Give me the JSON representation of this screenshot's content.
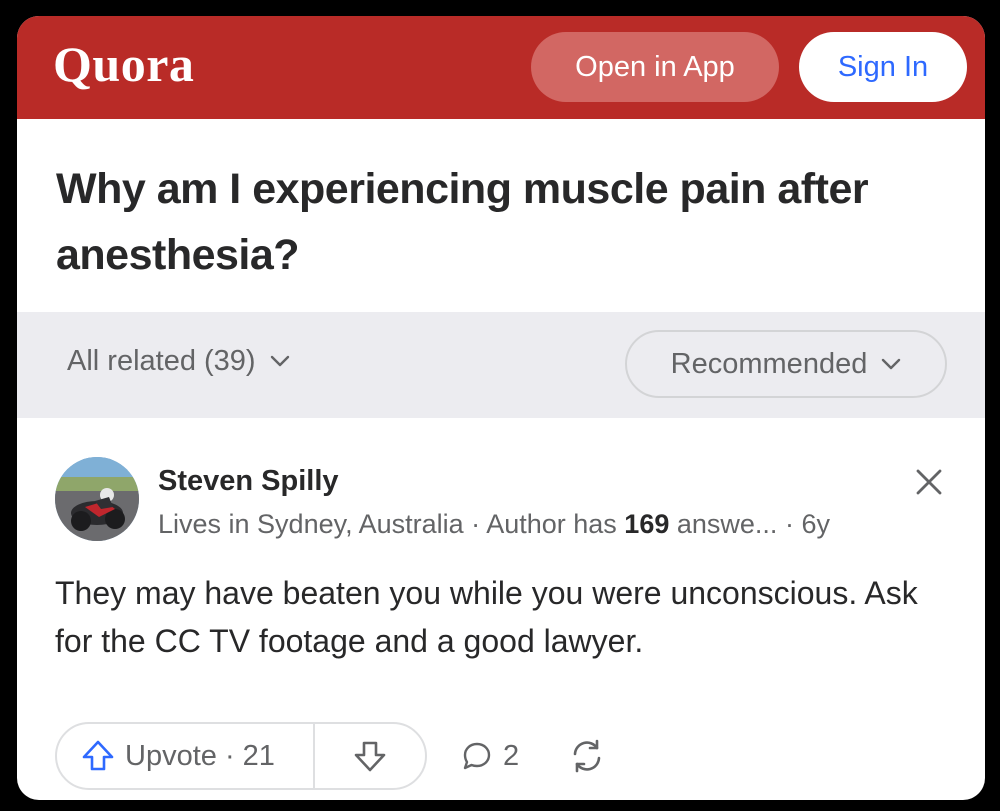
{
  "header": {
    "logo": "Quora",
    "open_in_app_label": "Open in App",
    "sign_in_label": "Sign In",
    "brand_color": "#b92b27"
  },
  "question": {
    "title": "Why am I experiencing muscle pain after anesthesia?"
  },
  "filters": {
    "all_related_label": "All related (39)",
    "sort_label": "Recommended",
    "icons": [
      "chevron-down-icon",
      "chevron-down-icon"
    ]
  },
  "answer": {
    "author_name": "Steven Spilly",
    "author_location": "Lives in Sydney, Australia",
    "author_credential_prefix": "Author has",
    "author_answer_count": "169",
    "author_credential_suffix": "answe...",
    "age": "6y",
    "text": "They may have beaten you while you were unconscious. Ask for the CC TV footage and a good lawyer.",
    "icons": [
      "avatar-image",
      "close-icon"
    ]
  },
  "actions": {
    "upvote_label": "Upvote",
    "upvote_count": "21",
    "comment_count": "2",
    "icons": [
      "upvote-arrow-icon",
      "downvote-arrow-icon",
      "comment-bubble-icon",
      "share-cycle-icon"
    ]
  }
}
